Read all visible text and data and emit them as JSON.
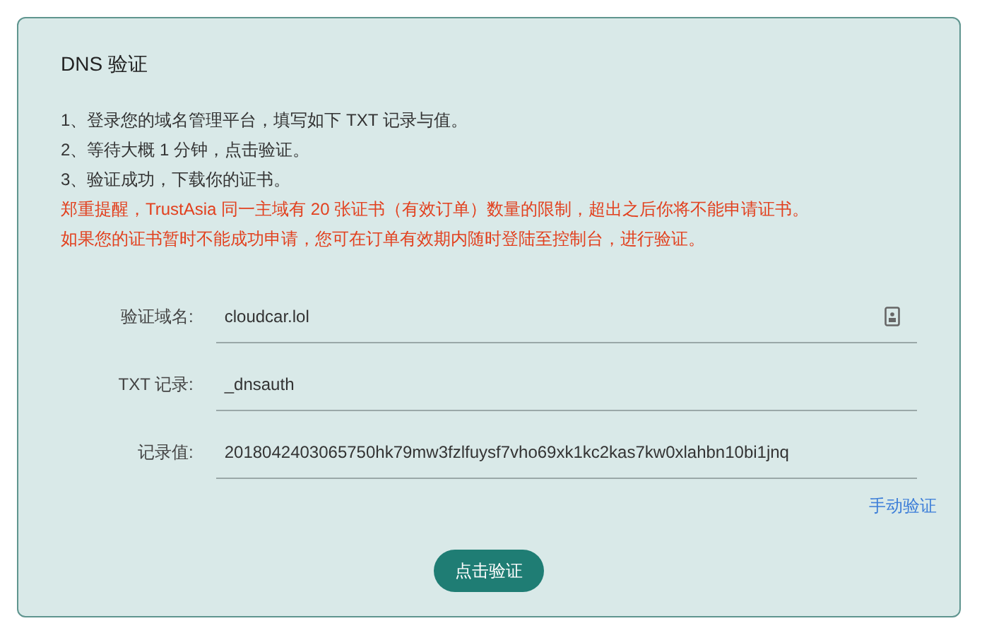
{
  "panel": {
    "title": "DNS 验证",
    "instructions": [
      {
        "kind": "step",
        "text": "1、登录您的域名管理平台，填写如下 TXT 记录与值。"
      },
      {
        "kind": "step",
        "text": "2、等待大概 1 分钟，点击验证。"
      },
      {
        "kind": "step",
        "text": "3、验证成功，下载你的证书。"
      },
      {
        "kind": "warning",
        "text": "郑重提醒，TrustAsia 同一主域有 20 张证书（有效订单）数量的限制，超出之后你将不能申请证书。"
      },
      {
        "kind": "warning",
        "text": "如果您的证书暂时不能成功申请，您可在订单有效期内随时登陆至控制台，进行验证。"
      }
    ],
    "fields": [
      {
        "label": "验证域名:",
        "value": "cloudcar.lol",
        "contact_icon": true
      },
      {
        "label": "TXT 记录:",
        "value": "_dnsauth",
        "contact_icon": false
      },
      {
        "label": "记录值:",
        "value": "2018042403065750hk79mw3fzlfuysf7vho69xk1kc2kas7kw0xlahbn10bi1jnq",
        "contact_icon": false
      }
    ],
    "manual_link": "手动验证",
    "verify_button": "点击验证"
  }
}
